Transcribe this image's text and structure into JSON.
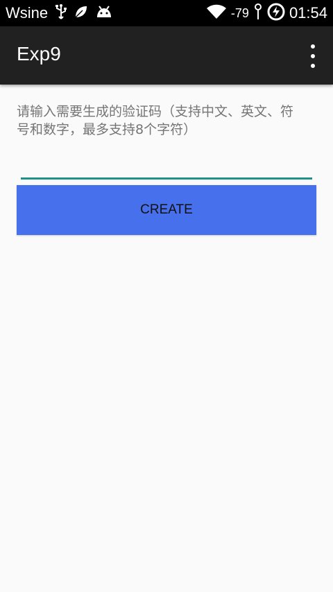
{
  "status_bar": {
    "carrier": "Wsine",
    "signal_strength": "-79",
    "time": "01:54",
    "icons": [
      "usb-icon",
      "leaf-icon",
      "android-icon",
      "wifi-icon",
      "signal-icon",
      "charging-icon"
    ]
  },
  "app_bar": {
    "title": "Exp9",
    "overflow_icon": "more-vert-icon"
  },
  "main": {
    "instructions": "请输入需要生成的验证码（支持中文、英文、符号和数字，最多支持8个字符）",
    "code_input_value": "",
    "create_label": "CREATE"
  },
  "colors": {
    "status_bar": "#000000",
    "app_bar": "#212121",
    "accent": "#1e9186",
    "button": "#4670ec",
    "background": "#fafafa"
  }
}
